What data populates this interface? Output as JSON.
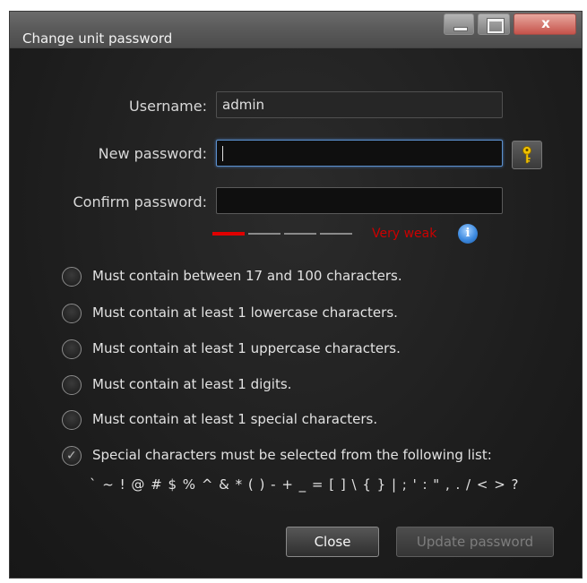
{
  "window": {
    "title": "Change unit password",
    "controls": {
      "close_glyph": "x"
    }
  },
  "form": {
    "username_label": "Username:",
    "username_value": "admin",
    "new_password_label": "New password:",
    "new_password_value": "",
    "confirm_password_label": "Confirm password:",
    "confirm_password_value": ""
  },
  "strength": {
    "level": 1,
    "segments": 4,
    "text": "Very weak",
    "color": "#e00000",
    "info_glyph": "i"
  },
  "rules": [
    {
      "text": "Must contain between 17 and 100 characters.",
      "checked": false
    },
    {
      "text": "Must contain at least 1 lowercase characters.",
      "checked": false
    },
    {
      "text": "Must contain at least 1 uppercase characters.",
      "checked": false
    },
    {
      "text": "Must contain at least 1 digits.",
      "checked": false
    },
    {
      "text": "Must contain at least 1 special characters.",
      "checked": false
    },
    {
      "text": "Special characters must be selected from the following list:",
      "checked": true
    }
  ],
  "special_characters": "` ~ ! @ # $ % ^ & * ( ) - + _ = [ ] \\ { } | ; ' : \" , . / < > ?",
  "icons": {
    "generate_password": "key-icon",
    "info": "info-icon",
    "check": "✓"
  },
  "buttons": {
    "close": "Close",
    "update": "Update password"
  },
  "colors": {
    "accent_focus": "#5b8fcc",
    "weak": "#e00000",
    "window_close": "#c5524a"
  }
}
